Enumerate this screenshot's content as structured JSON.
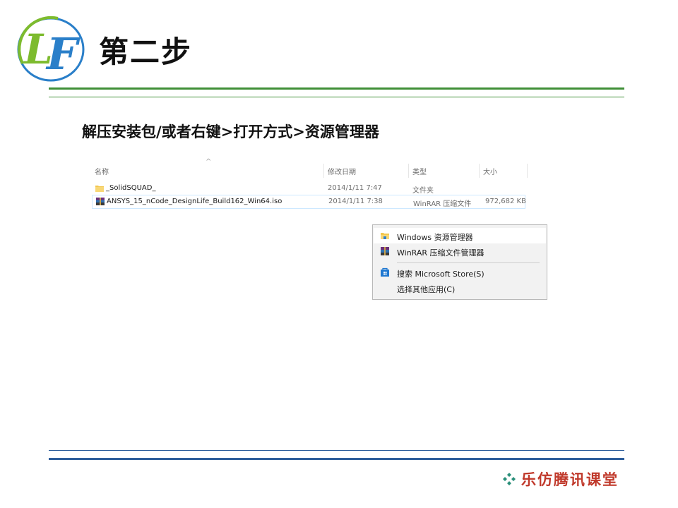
{
  "slide": {
    "title": "第二步",
    "instruction": "解压安装包/或者右键>打开方式>资源管理器",
    "logo_letters": "LF",
    "brand_name": "乐仿腾讯课堂"
  },
  "explorer": {
    "columns": {
      "name": "名称",
      "date": "修改日期",
      "type": "类型",
      "size": "大小"
    },
    "rows": [
      {
        "name": "_SolidSQUAD_",
        "date": "2014/1/11 7:47",
        "type": "文件夹",
        "size": "",
        "icon": "folder-icon"
      },
      {
        "name": "ANSYS_15_nCode_DesignLife_Build162_Win64.iso",
        "date": "2014/1/11 7:38",
        "type": "WinRAR 压缩文件",
        "size": "972,682 KB",
        "icon": "winrar-archive-icon",
        "selected": true
      }
    ]
  },
  "context_menu": {
    "items": [
      {
        "label": "Windows 资源管理器",
        "icon": "file-explorer-icon"
      },
      {
        "label": "WinRAR 压缩文件管理器",
        "icon": "winrar-icon"
      },
      {
        "label": "搜索 Microsoft Store(S)",
        "icon": "microsoft-store-icon"
      },
      {
        "label": "选择其他应用(C)",
        "icon": ""
      }
    ]
  },
  "colors": {
    "green_rule": "#3f8f37",
    "blue_rule": "#2f5f9c",
    "brand_red": "#c0392b",
    "logo_blue": "#2a7fc9",
    "logo_green": "#7dbb2e"
  }
}
